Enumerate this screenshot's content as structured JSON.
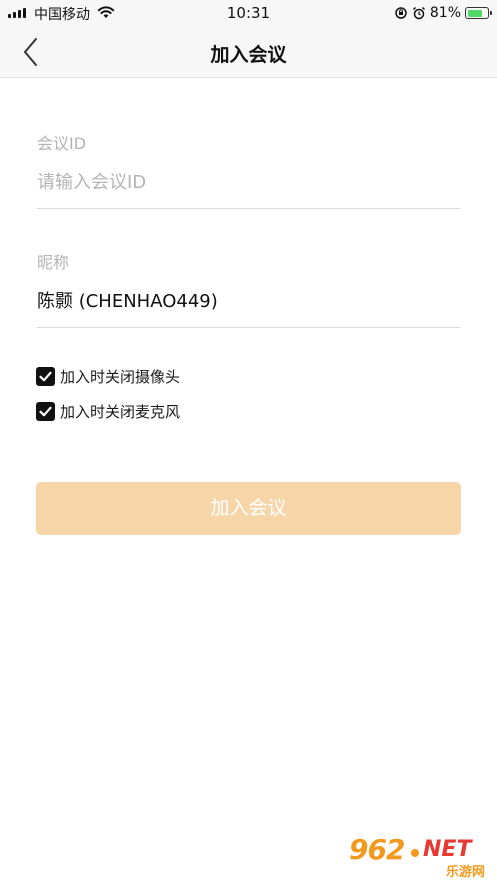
{
  "status_bar": {
    "carrier": "中国移动",
    "time": "10:31",
    "battery_percent": "81%",
    "battery_level": 0.81,
    "battery_color": "#4cd964"
  },
  "nav": {
    "back_icon": "chevron-left-icon",
    "title": "加入会议"
  },
  "form": {
    "meeting_id": {
      "label": "会议ID",
      "value": "",
      "placeholder": "请输入会议ID"
    },
    "nickname": {
      "label": "昵称",
      "value": "陈颢 (CHENHAO449)"
    },
    "options": [
      {
        "label": "加入时关闭摄像头",
        "checked": true
      },
      {
        "label": "加入时关闭麦克风",
        "checked": true
      }
    ],
    "join_button": {
      "label": "加入会议",
      "color": "#f6d6a8",
      "enabled": false
    }
  },
  "watermark": {
    "number": "962",
    "domain": "NET",
    "subtitle": "乐游网"
  }
}
